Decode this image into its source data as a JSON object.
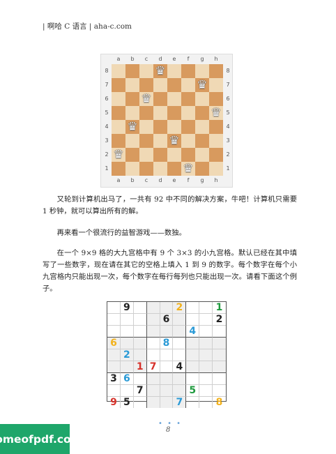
{
  "header": {
    "text": "| 啊哈 C 语言 |    aha-c.com"
  },
  "chess": {
    "files": [
      "a",
      "b",
      "c",
      "d",
      "e",
      "f",
      "g",
      "h"
    ],
    "ranks": [
      "8",
      "7",
      "6",
      "5",
      "4",
      "3",
      "2",
      "1"
    ],
    "queen_glyph": "♛",
    "queens": [
      {
        "file": "d",
        "rank": "8"
      },
      {
        "file": "g",
        "rank": "7"
      },
      {
        "file": "c",
        "rank": "6"
      },
      {
        "file": "h",
        "rank": "5"
      },
      {
        "file": "b",
        "rank": "4"
      },
      {
        "file": "e",
        "rank": "3"
      },
      {
        "file": "a",
        "rank": "2"
      },
      {
        "file": "f",
        "rank": "1"
      }
    ]
  },
  "paragraphs": [
    "又轮到计算机出马了，一共有 92 中不同的解决方案，牛吧！计算机只需要 1 秒钟，就可以算出所有的解。",
    "再来看一个很流行的益智游戏——数独。",
    "在一个 9×9 格的大九宫格中有 9 个 3×3 的小九宫格。默认已经在其中填写了一些数字，现在请在其它的空格上填入 1 到 9 的数字。每个数字在每个小九宫格内只能出现一次，每个数字在每行每列也只能出现一次。请看下面这个例子。"
  ],
  "sudoku": {
    "grid": [
      [
        "",
        "9",
        "",
        "",
        "",
        "2",
        "",
        "",
        "1"
      ],
      [
        "",
        "",
        "",
        "",
        "6",
        "",
        "",
        "",
        "2"
      ],
      [
        "",
        "",
        "",
        "",
        "",
        "",
        "4",
        "",
        ""
      ],
      [
        "6",
        "",
        "",
        "",
        "8",
        "",
        "",
        "",
        ""
      ],
      [
        "",
        "2",
        "",
        "",
        "",
        "",
        "",
        "",
        ""
      ],
      [
        "",
        "",
        "1",
        "7",
        "",
        "4",
        "",
        "",
        ""
      ],
      [
        "3",
        "6",
        "",
        "",
        "",
        "",
        "",
        "",
        ""
      ],
      [
        "",
        "",
        "7",
        "",
        "",
        "",
        "5",
        "",
        ""
      ],
      [
        "9",
        "5",
        "",
        "",
        "",
        "7",
        "",
        "",
        "8"
      ]
    ],
    "colors": [
      [
        "",
        "#222222",
        "",
        "",
        "",
        "#f2b21d",
        "",
        "",
        "#1f9a3e"
      ],
      [
        "",
        "",
        "",
        "",
        "#222222",
        "",
        "",
        "",
        "#222222"
      ],
      [
        "",
        "",
        "",
        "",
        "",
        "",
        "#2a9ad6",
        "",
        ""
      ],
      [
        "#f2b21d",
        "",
        "",
        "",
        "#2a9ad6",
        "",
        "",
        "",
        ""
      ],
      [
        "",
        "#2a9ad6",
        "",
        "",
        "",
        "",
        "",
        "",
        ""
      ],
      [
        "",
        "",
        "#d6312a",
        "#d6312a",
        "",
        "#222222",
        "",
        "",
        ""
      ],
      [
        "#222222",
        "#2a9ad6",
        "",
        "",
        "",
        "",
        "",
        "",
        ""
      ],
      [
        "",
        "",
        "#222222",
        "",
        "",
        "",
        "#1f9a3e",
        "",
        ""
      ],
      [
        "#d6312a",
        "#222222",
        "",
        "",
        "",
        "#2a9ad6",
        "",
        "",
        "#f2b21d"
      ]
    ]
  },
  "footer": {
    "dots": "• • •",
    "page_number": "8"
  },
  "watermark": {
    "text": "homeofpdf.com"
  }
}
